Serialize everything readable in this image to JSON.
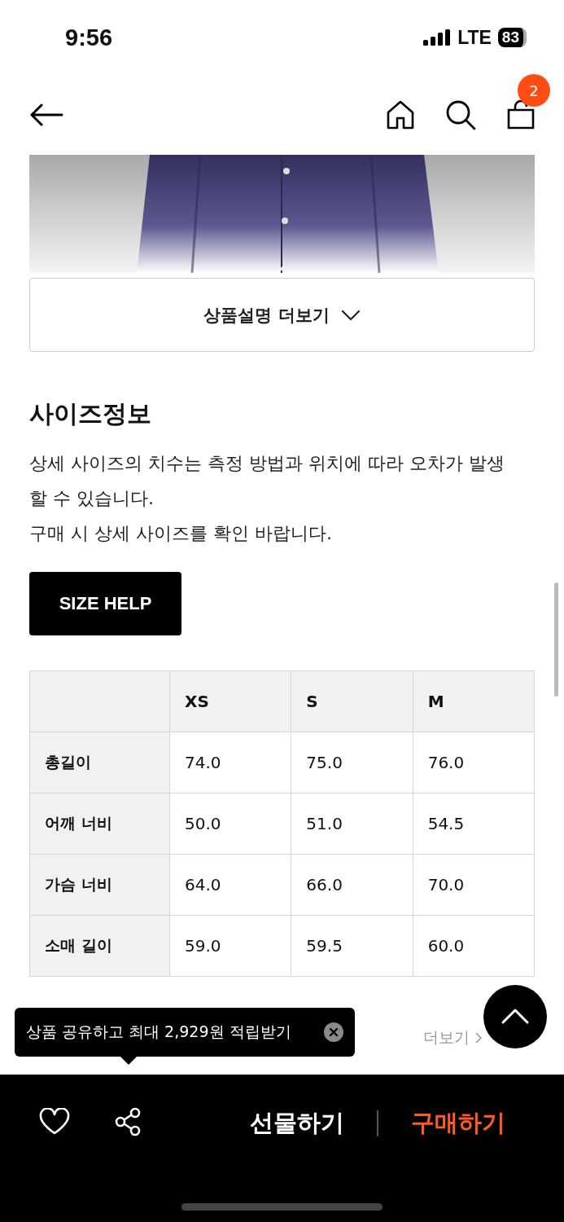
{
  "status_bar": {
    "time": "9:56",
    "network": "LTE",
    "battery": "83"
  },
  "nav": {
    "cart_count": "2"
  },
  "more_description_button": "상품설명 더보기",
  "size_info": {
    "title": "사이즈정보",
    "notes": [
      "상세 사이즈의 치수는 측정 방법과 위치에 따라 오차가 발생할 수 있습니다.",
      "구매 시 상세 사이즈를 확인 바랍니다."
    ],
    "help_button": "SIZE HELP",
    "table": {
      "columns": [
        "XS",
        "S",
        "M"
      ],
      "rows": [
        {
          "label": "총길이",
          "values": [
            "74.0",
            "75.0",
            "76.0"
          ]
        },
        {
          "label": "어깨 너비",
          "values": [
            "50.0",
            "51.0",
            "54.5"
          ]
        },
        {
          "label": "가슴 너비",
          "values": [
            "64.0",
            "66.0",
            "70.0"
          ]
        },
        {
          "label": "소매 길이",
          "values": [
            "59.0",
            "59.5",
            "60.0"
          ]
        }
      ]
    }
  },
  "more_link": "더보기",
  "tooltip": {
    "text": "상품 공유하고 최대 2,929원 적립받기"
  },
  "bottom_bar": {
    "liked": false,
    "gift_button": "선물하기",
    "buy_button": "구매하기"
  }
}
